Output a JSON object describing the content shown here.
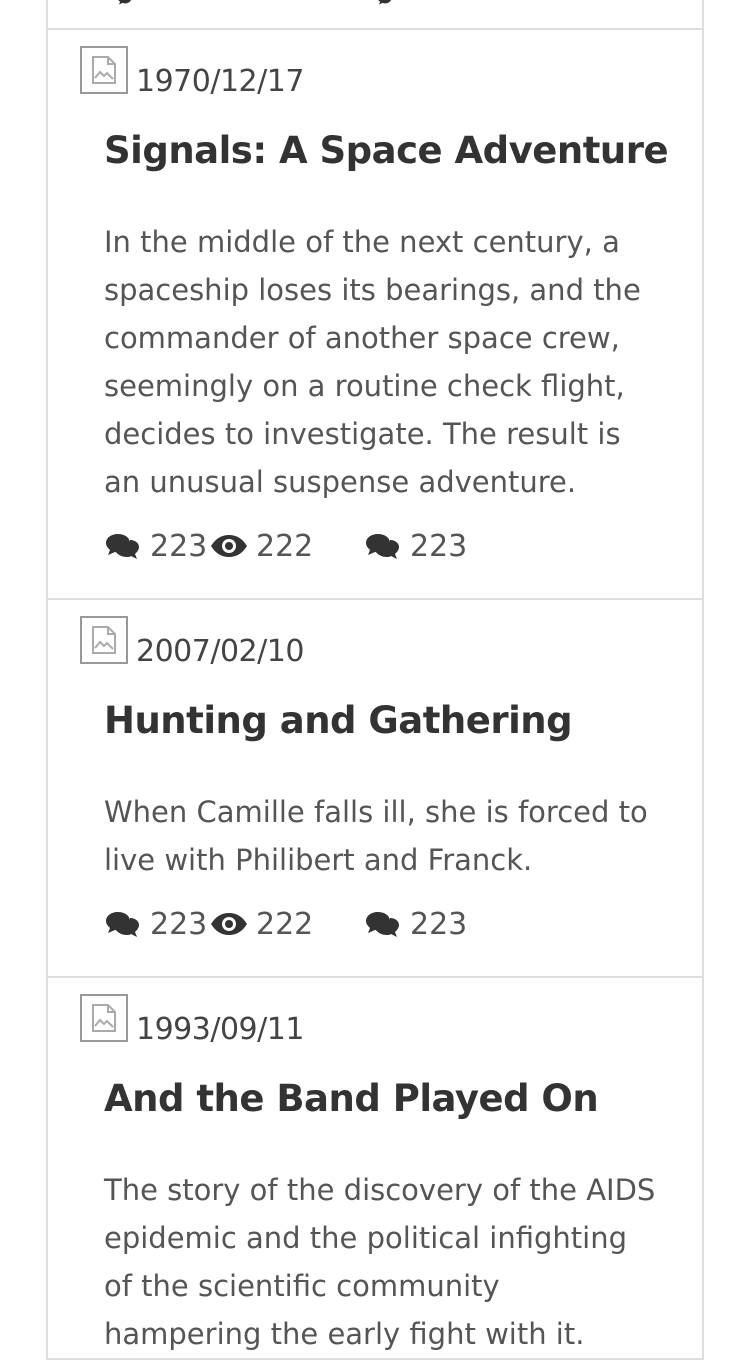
{
  "posts": [
    {
      "date": "1970/12/17",
      "title": "Signals: A Space Adventure",
      "description": "In the middle of the next century, a spaceship loses its bearings, and the commander of another space crew, seemingly on a routine check flight, decides to investigate. The result is an unusual suspense adventure.",
      "comments": "223",
      "views": "222",
      "replies": "223"
    },
    {
      "date": "2007/02/10",
      "title": "Hunting and Gathering",
      "description": "When Camille falls ill, she is forced to live with Philibert and Franck.",
      "comments": "223",
      "views": "222",
      "replies": "223"
    },
    {
      "date": "1993/09/11",
      "title": "And the Band Played On",
      "description": "The story of the discovery of the AIDS epidemic and the political infighting of the scientific community hampering the early fight with it.",
      "comments": "",
      "views": "",
      "replies": ""
    }
  ],
  "icons": {
    "thumbnail": "broken-image-icon",
    "comments": "comments-icon",
    "views": "eye-icon",
    "replies": "comments-icon"
  }
}
